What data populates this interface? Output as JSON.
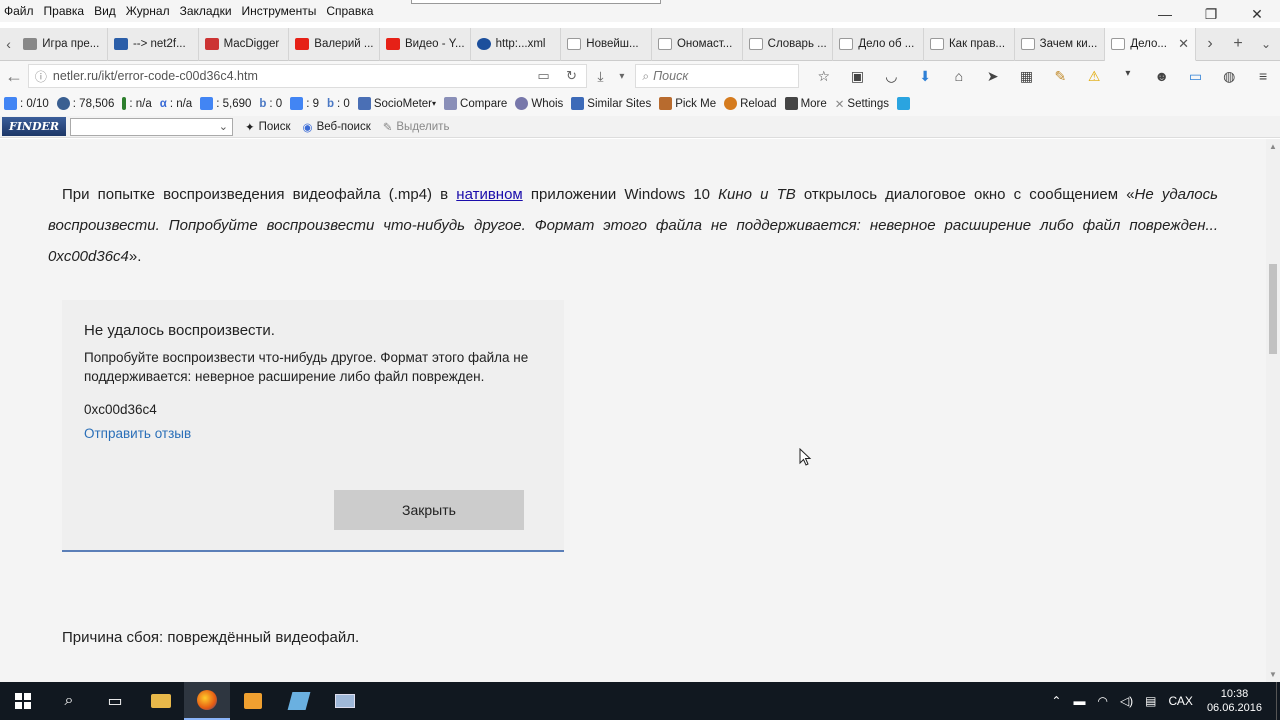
{
  "menubar": {
    "items": [
      "Файл",
      "Правка",
      "Вид",
      "Журнал",
      "Закладки",
      "Инструменты",
      "Справка"
    ]
  },
  "window_controls": {
    "minimize": "—",
    "restore": "❐",
    "close": "✕"
  },
  "tabs": [
    {
      "label": "Игра пре...",
      "color": "#888888"
    },
    {
      "label": "--> net2f...",
      "color": "#2b5ea8"
    },
    {
      "label": "MacDigger",
      "color": "#cc3333"
    },
    {
      "label": "Валерий ...",
      "color": "#e62117"
    },
    {
      "label": "Видео - Y...",
      "color": "#e62117"
    },
    {
      "label": "http:...xml",
      "color": "#1c4f9c"
    },
    {
      "label": "Новейш...",
      "color": "#aaaaaa"
    },
    {
      "label": "Ономаст...",
      "color": "#aaaaaa"
    },
    {
      "label": "Словарь ...",
      "color": "#aaaaaa"
    },
    {
      "label": "Дело об ...",
      "color": "#aaaaaa"
    },
    {
      "label": "Как прав...",
      "color": "#aaaaaa"
    },
    {
      "label": "Зачем ки...",
      "color": "#aaaaaa"
    },
    {
      "label": "Дело...",
      "color": "#aaaaaa",
      "active": true
    }
  ],
  "navbar": {
    "url": "netler.ru/ikt/error-code-c00d36c4.htm",
    "search_placeholder": "Поиск"
  },
  "seobar": {
    "items": [
      {
        "label": ": 0/10",
        "color": "#4285f4"
      },
      {
        "label": ": 78,506",
        "color": "#3a5f91"
      },
      {
        "label": ": n/a",
        "color": "#2d7f2d"
      },
      {
        "label": ": n/a",
        "color": "#3a6bd6"
      },
      {
        "label": ": 5,690",
        "color": "#4285f4"
      },
      {
        "label": ": 0",
        "color": "#4a78c4"
      },
      {
        "label": ": 9",
        "color": "#4285f4"
      },
      {
        "label": ": 0",
        "color": "#4a78c4"
      },
      {
        "label": "SocioMeter",
        "color": "#4a6fb5"
      },
      {
        "label": "Compare",
        "color": "#8a8fb8"
      },
      {
        "label": "Whois",
        "color": "#7777aa"
      },
      {
        "label": "Similar Sites",
        "color": "#3c6ab8"
      },
      {
        "label": "Pick Me",
        "color": "#b86b2e"
      },
      {
        "label": "Reload",
        "color": "#d57b1e"
      },
      {
        "label": "More",
        "color": "#444444"
      },
      {
        "label": "Settings",
        "color": "#888888"
      },
      {
        "label": "",
        "color": "#2aa4e0"
      }
    ]
  },
  "finderbar": {
    "logo": "FINDER",
    "search_label": "Поиск",
    "web_search_label": "Веб-поиск",
    "highlight_label": "Выделить"
  },
  "content": {
    "para_part1": "При попытке воспроизведения видеофайла (.mp4) в ",
    "para_link": "нативном",
    "para_part2": " приложении Windows 10 ",
    "para_app": "Кино и ТВ",
    "para_part3": " открылось диалоговое окно с сообщением «",
    "para_quote": "Не удалось воспроизвести. Попробуйте воспроизвести что-нибудь другое. Формат этого файла не поддерживается: неверное расширение либо файл поврежден... 0xc00d36c4",
    "para_part4": "».",
    "dialog": {
      "title": "Не удалось воспроизвести.",
      "message": "Попробуйте воспроизвести что-нибудь другое. Формат этого файла не поддерживается: неверное расширение либо файл поврежден.",
      "code": "0xc00d36c4",
      "link": "Отправить отзыв",
      "button": "Закрыть"
    },
    "cause": "Причина сбоя: повреждённый видеофайл."
  },
  "taskbar": {
    "language": "САХ",
    "time": "10:38",
    "date": "06.06.2016"
  }
}
